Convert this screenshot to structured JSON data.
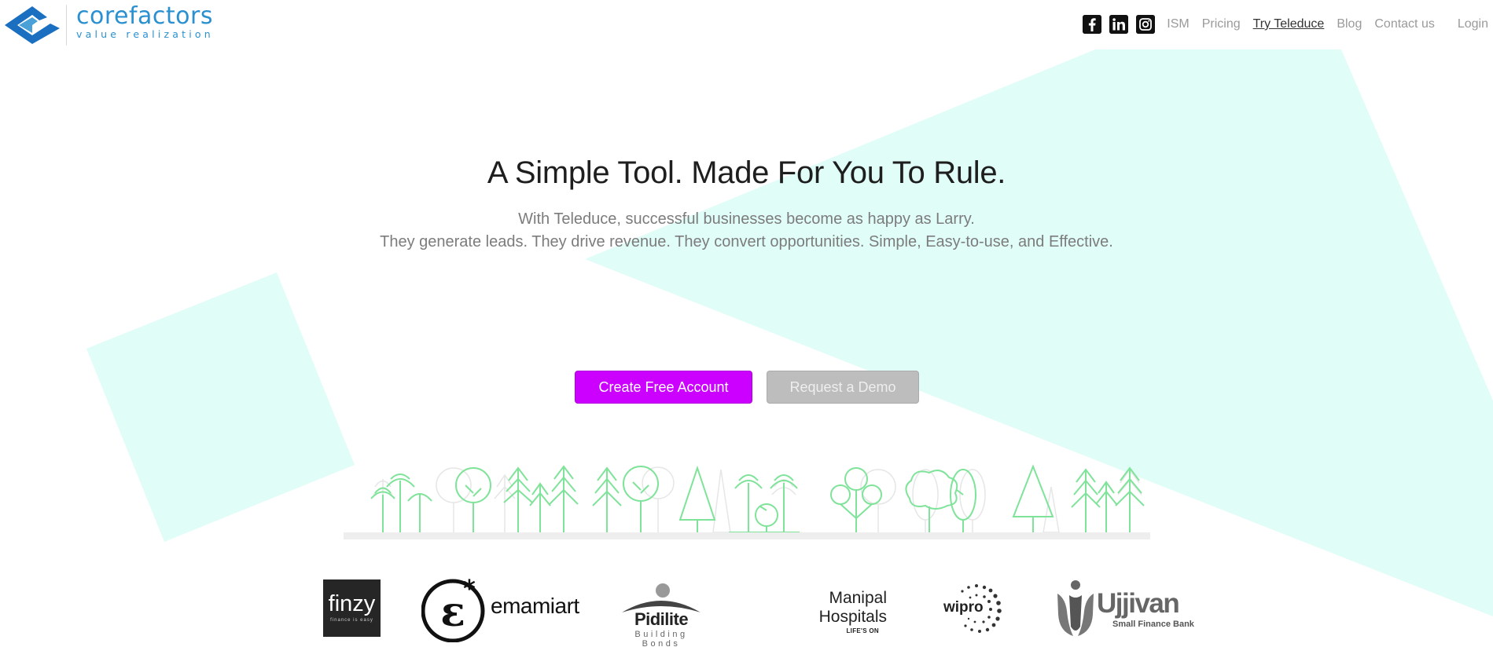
{
  "header": {
    "logo": {
      "name": "corefactors",
      "tagline": "value realization"
    },
    "social_icons": [
      "facebook-icon",
      "linkedin-icon",
      "instagram-icon"
    ],
    "nav": [
      {
        "label": "ISM",
        "active": false
      },
      {
        "label": "Pricing",
        "active": false
      },
      {
        "label": "Try Teleduce",
        "active": true
      },
      {
        "label": "Blog",
        "active": false
      },
      {
        "label": "Contact us",
        "active": false
      }
    ],
    "login_label": "Login"
  },
  "hero": {
    "headline": "A Simple Tool. Made For You To Rule.",
    "subline1": "With Teleduce, successful businesses become as happy as Larry.",
    "subline2": "They generate leads. They drive revenue. They convert opportunities. Simple, Easy-to-use, and Effective."
  },
  "buttons": {
    "primary": "Create Free Account",
    "secondary": "Request a Demo"
  },
  "clients": [
    {
      "name": "finzy",
      "tag": "finance is easy"
    },
    {
      "name": "emamiart"
    },
    {
      "name": "Pidilite",
      "tag": "Building Bonds"
    },
    {
      "name": "Manipal Hospitals",
      "line1": "Manipal",
      "line2": "Hospitals",
      "tag": "LIFE'S ON"
    },
    {
      "name": "wipro"
    },
    {
      "name": "Ujjivan",
      "tag": "Small Finance Bank"
    }
  ],
  "colors": {
    "brand_blue": "#2a90d0",
    "accent_mint": "#e0fdf7",
    "primary_button": "#cc00ff",
    "secondary_button": "#bdbdbd",
    "tree_green": "#7fe39a"
  }
}
